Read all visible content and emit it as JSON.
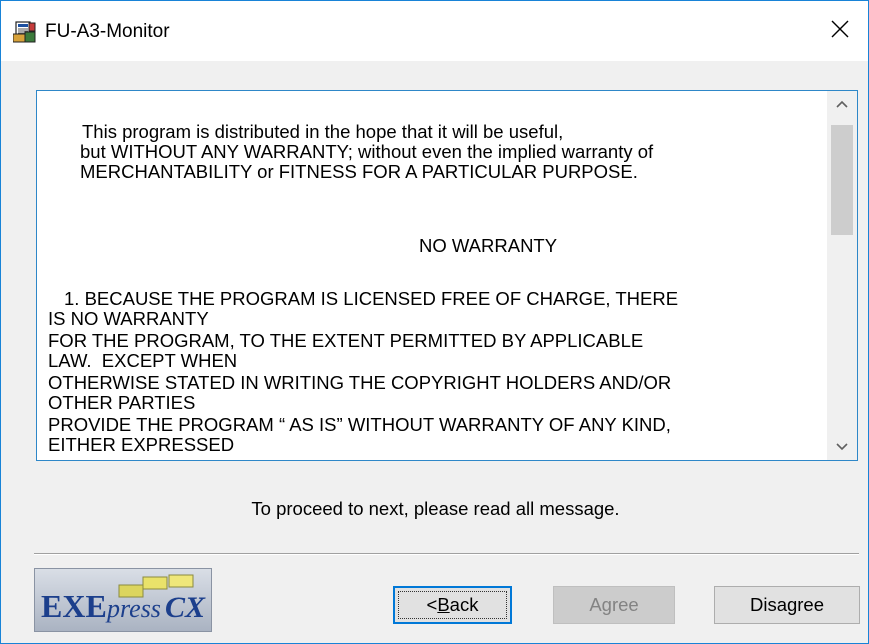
{
  "window": {
    "title": "FU-A3-Monitor",
    "close_glyph": "✕"
  },
  "license": {
    "lines": [
      "This program is distributed in the hope that it will be useful,",
      "but WITHOUT ANY WARRANTY; without even the implied warranty of",
      "MERCHANTABILITY or FITNESS FOR A PARTICULAR PURPOSE.",
      "NO WARRANTY",
      "1. BECAUSE THE PROGRAM IS LICENSED FREE OF CHARGE, THERE",
      "IS NO WARRANTY",
      "FOR THE PROGRAM, TO THE EXTENT PERMITTED BY APPLICABLE",
      "LAW.  EXCEPT WHEN",
      "OTHERWISE STATED IN WRITING THE COPYRIGHT HOLDERS AND/OR",
      "OTHER PARTIES",
      "PROVIDE THE PROGRAM “ AS IS” WITHOUT WARRANTY OF ANY KIND,",
      "EITHER EXPRESSED"
    ]
  },
  "notice": "To proceed to next, please read all message.",
  "logo": {
    "text_main": "EXE",
    "text_italic": "press",
    "text_end": "CX"
  },
  "buttons": {
    "back_prefix": "< ",
    "back_mnemonic": "B",
    "back_rest": "ack",
    "agree": "Agree",
    "disagree": "Disagree"
  }
}
